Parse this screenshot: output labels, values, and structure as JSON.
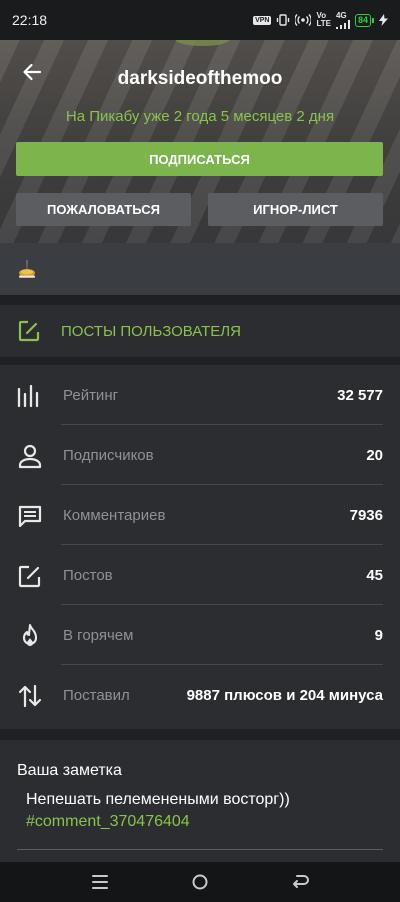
{
  "status_bar": {
    "time": "22:18",
    "vpn": "VPN",
    "volte_top": "Vo",
    "volte_bottom": "LTE",
    "network": "4G",
    "battery": "84"
  },
  "profile": {
    "username": "darksideofthemoo",
    "since": "На Пикабу уже 2 года 5 месяцев 2 дня",
    "subscribe_label": "ПОДПИСАТЬСЯ",
    "report_label": "ПОЖАЛОВАТЬСЯ",
    "ignore_label": "ИГНОР-ЛИСТ",
    "accent": "#8bc34a",
    "subscribe_bg": "#7bb54b"
  },
  "badges": [
    "award-badge"
  ],
  "posts_link": {
    "label": "ПОСТЫ ПОЛЬЗОВАТЕЛЯ",
    "icon": "edit-icon"
  },
  "stats": [
    {
      "icon": "rating-bars-icon",
      "label": "Рейтинг",
      "value": "32 577"
    },
    {
      "icon": "person-icon",
      "label": "Подписчиков",
      "value": "20"
    },
    {
      "icon": "comment-icon",
      "label": "Комментариев",
      "value": "7936"
    },
    {
      "icon": "edit-icon",
      "label": "Постов",
      "value": "45"
    },
    {
      "icon": "fire-icon",
      "label": "В горячем",
      "value": "9"
    },
    {
      "icon": "up-down-arrows-icon",
      "label": "Поставил",
      "value": "9887 плюсов и 204 минуса"
    }
  ],
  "note": {
    "title": "Ваша заметка",
    "text": "Непешать пелеменеными восторг))",
    "tag": "#comment_370476404"
  },
  "navbar": [
    "menu-icon",
    "home-icon",
    "back-icon"
  ]
}
